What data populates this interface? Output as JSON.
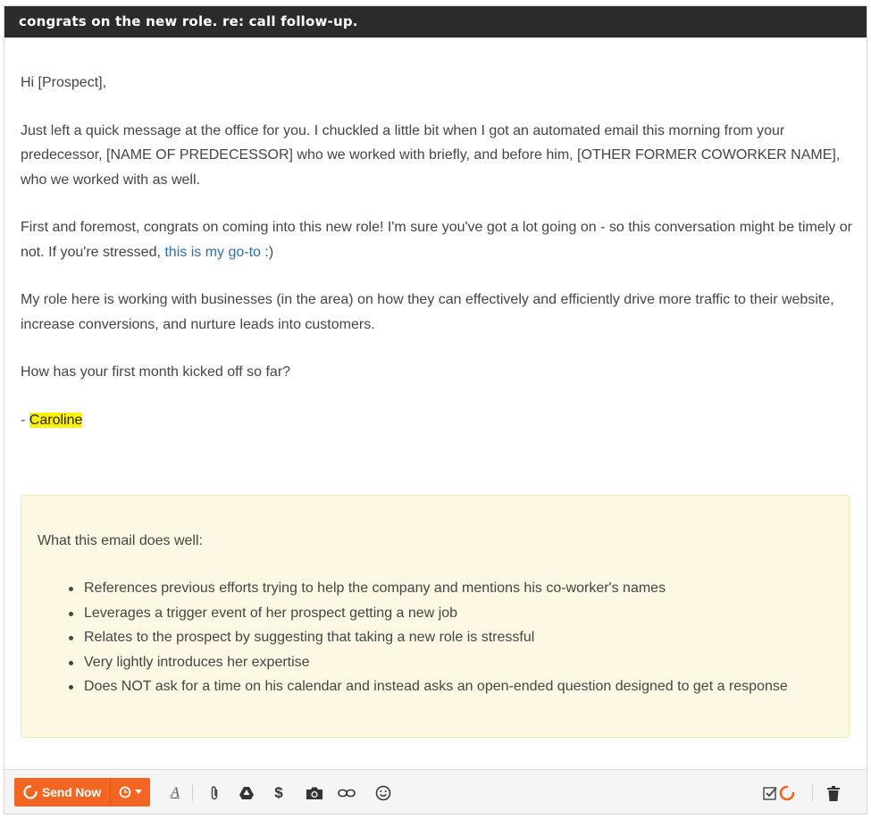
{
  "email": {
    "subject": "congrats on the new role. re: call follow-up.",
    "greeting": "Hi [Prospect],",
    "para1": "Just left a quick message at the office for you. I chuckled a little bit when I got an automated email this morning from your predecessor, [NAME OF PREDECESSOR] who we worked with briefly, and before him, [OTHER FORMER COWORKER NAME], who we worked with as well.",
    "para2_before_link": "First and foremost, congrats on coming into this new role! I'm sure you've got a lot going on - so this conversation might be timely or not. If you're stressed, ",
    "para2_link": "this is my go-to",
    "para2_after_link": " :)",
    "para3": "My role here is working with businesses (in the area) on how they can effectively and efficiently drive more traffic to their website, increase conversions, and nurture leads into customers.",
    "question": "How has your first month kicked off so far?",
    "signoff_prefix": "- ",
    "signature": "Caroline"
  },
  "callout": {
    "title": "What this email does well:",
    "items": [
      "References previous efforts trying to help the company and mentions his co-worker's names",
      "Leverages a trigger event of her prospect getting a new job",
      "Relates to the prospect by suggesting that taking a new role is stressful",
      "Very lightly introduces her expertise",
      "Does NOT ask for a time on his calendar and instead asks an open-ended question designed to get a response"
    ]
  },
  "toolbar": {
    "send_label": "Send Now",
    "accent_color": "#f26522"
  }
}
